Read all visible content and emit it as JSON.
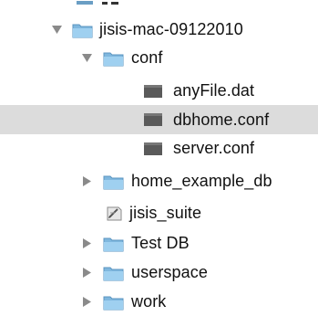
{
  "tree": {
    "rows": [
      {
        "label": "",
        "type": "partial"
      },
      {
        "label": "jisis-mac-09122010",
        "type": "folder",
        "expanded": true,
        "selected": false
      },
      {
        "label": "conf",
        "type": "folder",
        "expanded": true,
        "selected": false
      },
      {
        "label": "anyFile.dat",
        "type": "file",
        "selected": false
      },
      {
        "label": "dbhome.conf",
        "type": "file",
        "selected": true
      },
      {
        "label": "server.conf",
        "type": "file",
        "selected": false
      },
      {
        "label": "home_example_db",
        "type": "folder",
        "expanded": false,
        "selected": false
      },
      {
        "label": "jisis_suite",
        "type": "executable",
        "selected": false
      },
      {
        "label": "Test DB",
        "type": "folder",
        "expanded": false,
        "selected": false
      },
      {
        "label": "userspace",
        "type": "folder",
        "expanded": false,
        "selected": false
      },
      {
        "label": "work",
        "type": "folder",
        "expanded": false,
        "selected": false
      }
    ]
  },
  "colors": {
    "selection": "#dcdcdc",
    "folder_blue": "#8fc3e6",
    "disclosure_gray": "#8a8a8a"
  },
  "icons": {
    "folder": "folder-icon",
    "file": "file-icon",
    "executable": "executable-script-icon",
    "expanded": "disclosure-triangle-down-icon",
    "collapsed": "disclosure-triangle-right-icon"
  }
}
